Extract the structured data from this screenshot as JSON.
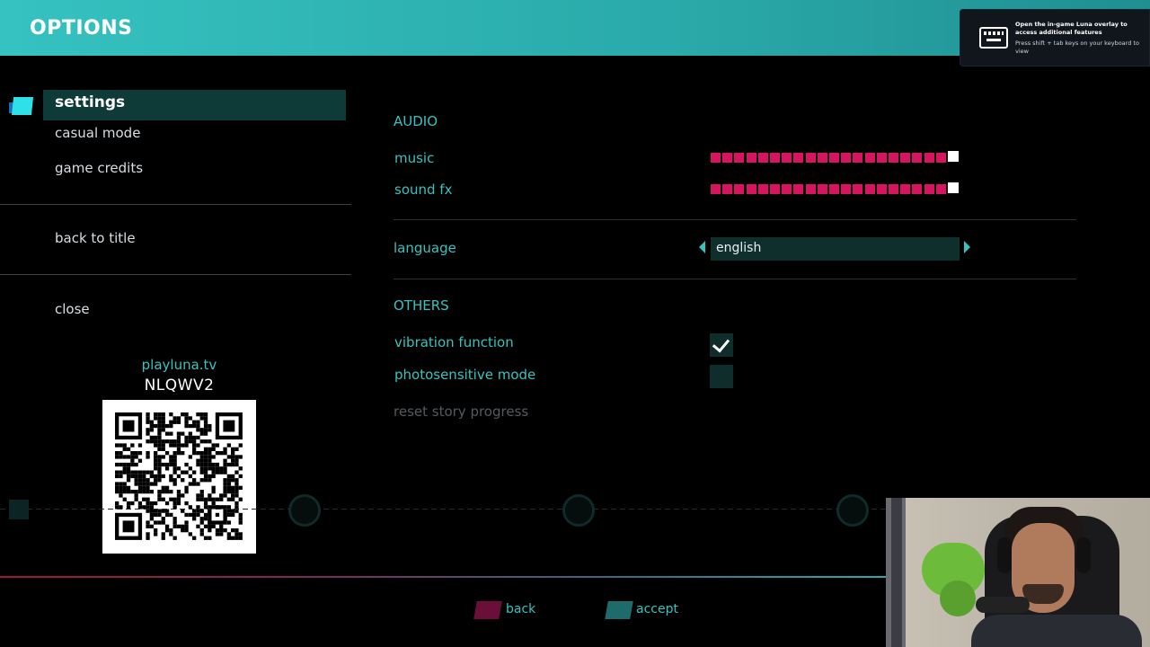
{
  "header": {
    "title": "OPTIONS"
  },
  "luna_tip": {
    "title": "Open the in-game Luna overlay to access additional features",
    "body": "Press shift + tab keys on your keyboard to view",
    "icon": "keyboard-icon"
  },
  "menu": {
    "items": [
      "settings",
      "casual mode",
      "game credits",
      "back to title",
      "close"
    ],
    "selected": "settings"
  },
  "luna": {
    "url": "playluna.tv",
    "code": "NLQWV2"
  },
  "audio": {
    "title": "AUDIO",
    "music": {
      "label": "music",
      "level": 1.0
    },
    "sound_fx": {
      "label": "sound fx",
      "level": 1.0
    }
  },
  "language": {
    "label": "language",
    "value": "english"
  },
  "others": {
    "title": "OTHERS",
    "vibration": {
      "label": "vibration function",
      "checked": true
    },
    "photosensitive": {
      "label": "photosensitive mode",
      "checked": false
    },
    "reset": "reset story progress"
  },
  "footer": {
    "back": {
      "label": "back",
      "color": "#6b0f3a"
    },
    "accept": {
      "label": "accept",
      "color": "#1d6b6a"
    }
  },
  "colors": {
    "accent": "#36c3bf",
    "slider": "#d6145f",
    "header": "#35c2c0"
  }
}
